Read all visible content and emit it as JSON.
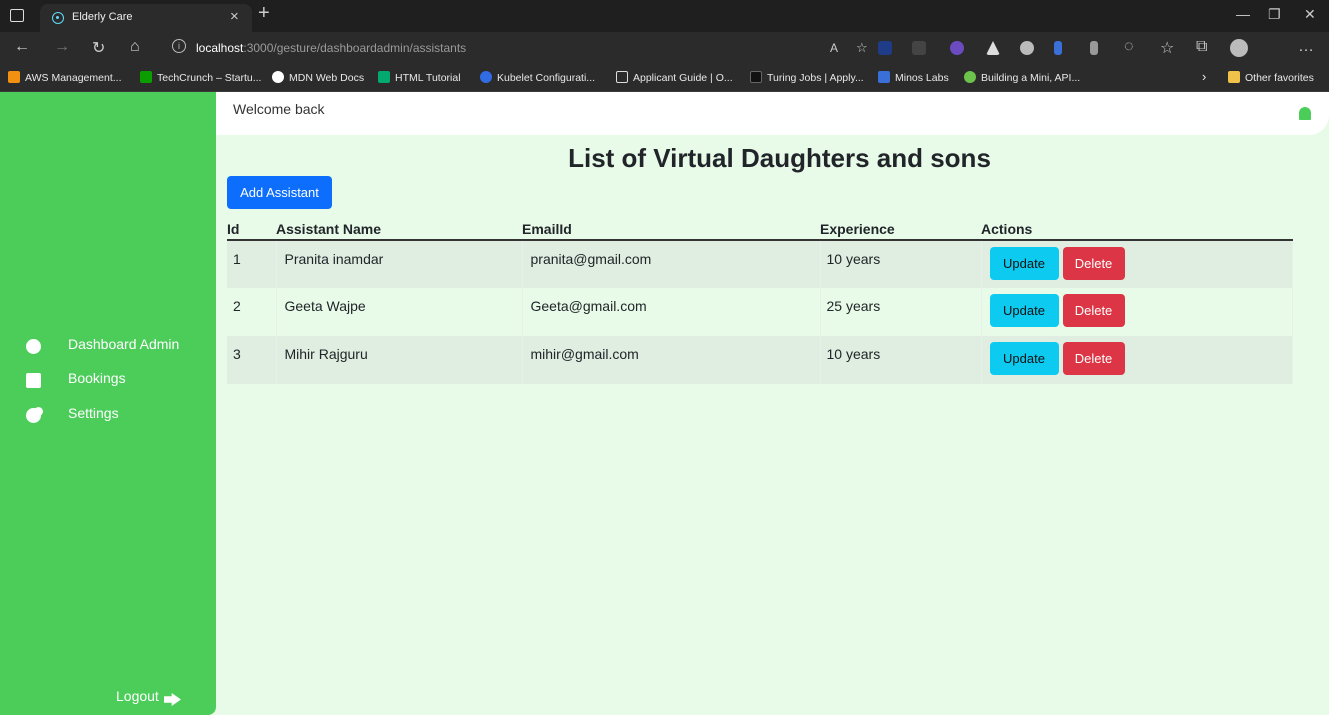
{
  "browser": {
    "tab_title": "Elderly Care",
    "tab_close": "×",
    "new_tab": "+",
    "url_host": "localhost",
    "url_path": ":3000/gesture/dashboardadmin/assistants",
    "bookmarks": [
      "AWS Management...",
      "TechCrunch – Startu...",
      "MDN Web Docs",
      "HTML Tutorial",
      "Kubelet Configurati...",
      "Applicant Guide | O...",
      "Turing Jobs | Apply...",
      "Minos Labs",
      "Building a Mini, API..."
    ],
    "other_favorites": "Other favorites"
  },
  "header": {
    "welcome": "Welcome back"
  },
  "sidebar": {
    "items": [
      {
        "label": "Dashboard Admin",
        "icon": "gauge-icon"
      },
      {
        "label": "Bookings",
        "icon": "book-icon"
      },
      {
        "label": "Settings",
        "icon": "cogs-icon"
      }
    ],
    "logout": "Logout"
  },
  "main": {
    "title": "List of Virtual Daughters and sons",
    "add_button": "Add Assistant",
    "table": {
      "headers": [
        "Id",
        "Assistant Name",
        "EmailId",
        "Experience",
        "Actions"
      ],
      "rows": [
        {
          "id": "1",
          "name": "Pranita inamdar",
          "email": "pranita@gmail.com",
          "experience": "10 years"
        },
        {
          "id": "2",
          "name": "Geeta Wajpe",
          "email": "Geeta@gmail.com",
          "experience": "25 years"
        },
        {
          "id": "3",
          "name": "Mihir Rajguru",
          "email": "mihir@gmail.com",
          "experience": "10 years"
        }
      ],
      "update_label": "Update",
      "delete_label": "Delete"
    }
  },
  "colors": {
    "sidebar": "#4ccd5a",
    "background": "#e8fbe9",
    "primary": "#0d6efd",
    "info": "#0dcaf0",
    "danger": "#dc3545"
  }
}
